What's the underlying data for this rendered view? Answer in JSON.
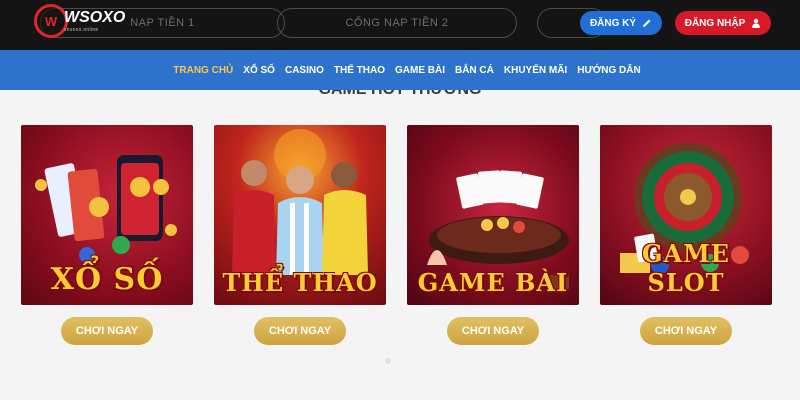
{
  "header": {
    "logo_badge": "W",
    "logo_name": "WSOXO",
    "logo_sub": "vnsoxo.online",
    "pills": [
      "NẠP TIỀN 1",
      "CỔNG NẠP TIỀN 2",
      ""
    ],
    "register_label": "ĐĂNG KÝ",
    "login_label": "ĐĂNG NHẬP",
    "register_color": "#1f6fd6",
    "login_color": "#d7192a"
  },
  "nav": {
    "items": [
      "TRANG CHỦ",
      "XỔ SỐ",
      "CASINO",
      "THỂ THAO",
      "GAME BÀI",
      "BẮN CÁ",
      "KHUYẾN MÃI",
      "HƯỚNG DẪN"
    ],
    "active_index": 0,
    "active_color": "#f2c94c"
  },
  "section_title": "GAME HOT THƯỜNG",
  "cards": [
    {
      "title": "XỔ SỐ",
      "button": "CHƠI NGAY",
      "icon": "lottery-icon"
    },
    {
      "title": "THỂ THAO",
      "button": "CHƠI NGAY",
      "icon": "football-players-icon"
    },
    {
      "title": "GAME BÀI",
      "button": "CHƠI NGAY",
      "icon": "cards-table-icon"
    },
    {
      "title": "GAME SLOT",
      "button": "CHƠI NGAY",
      "icon": "roulette-icon"
    }
  ]
}
